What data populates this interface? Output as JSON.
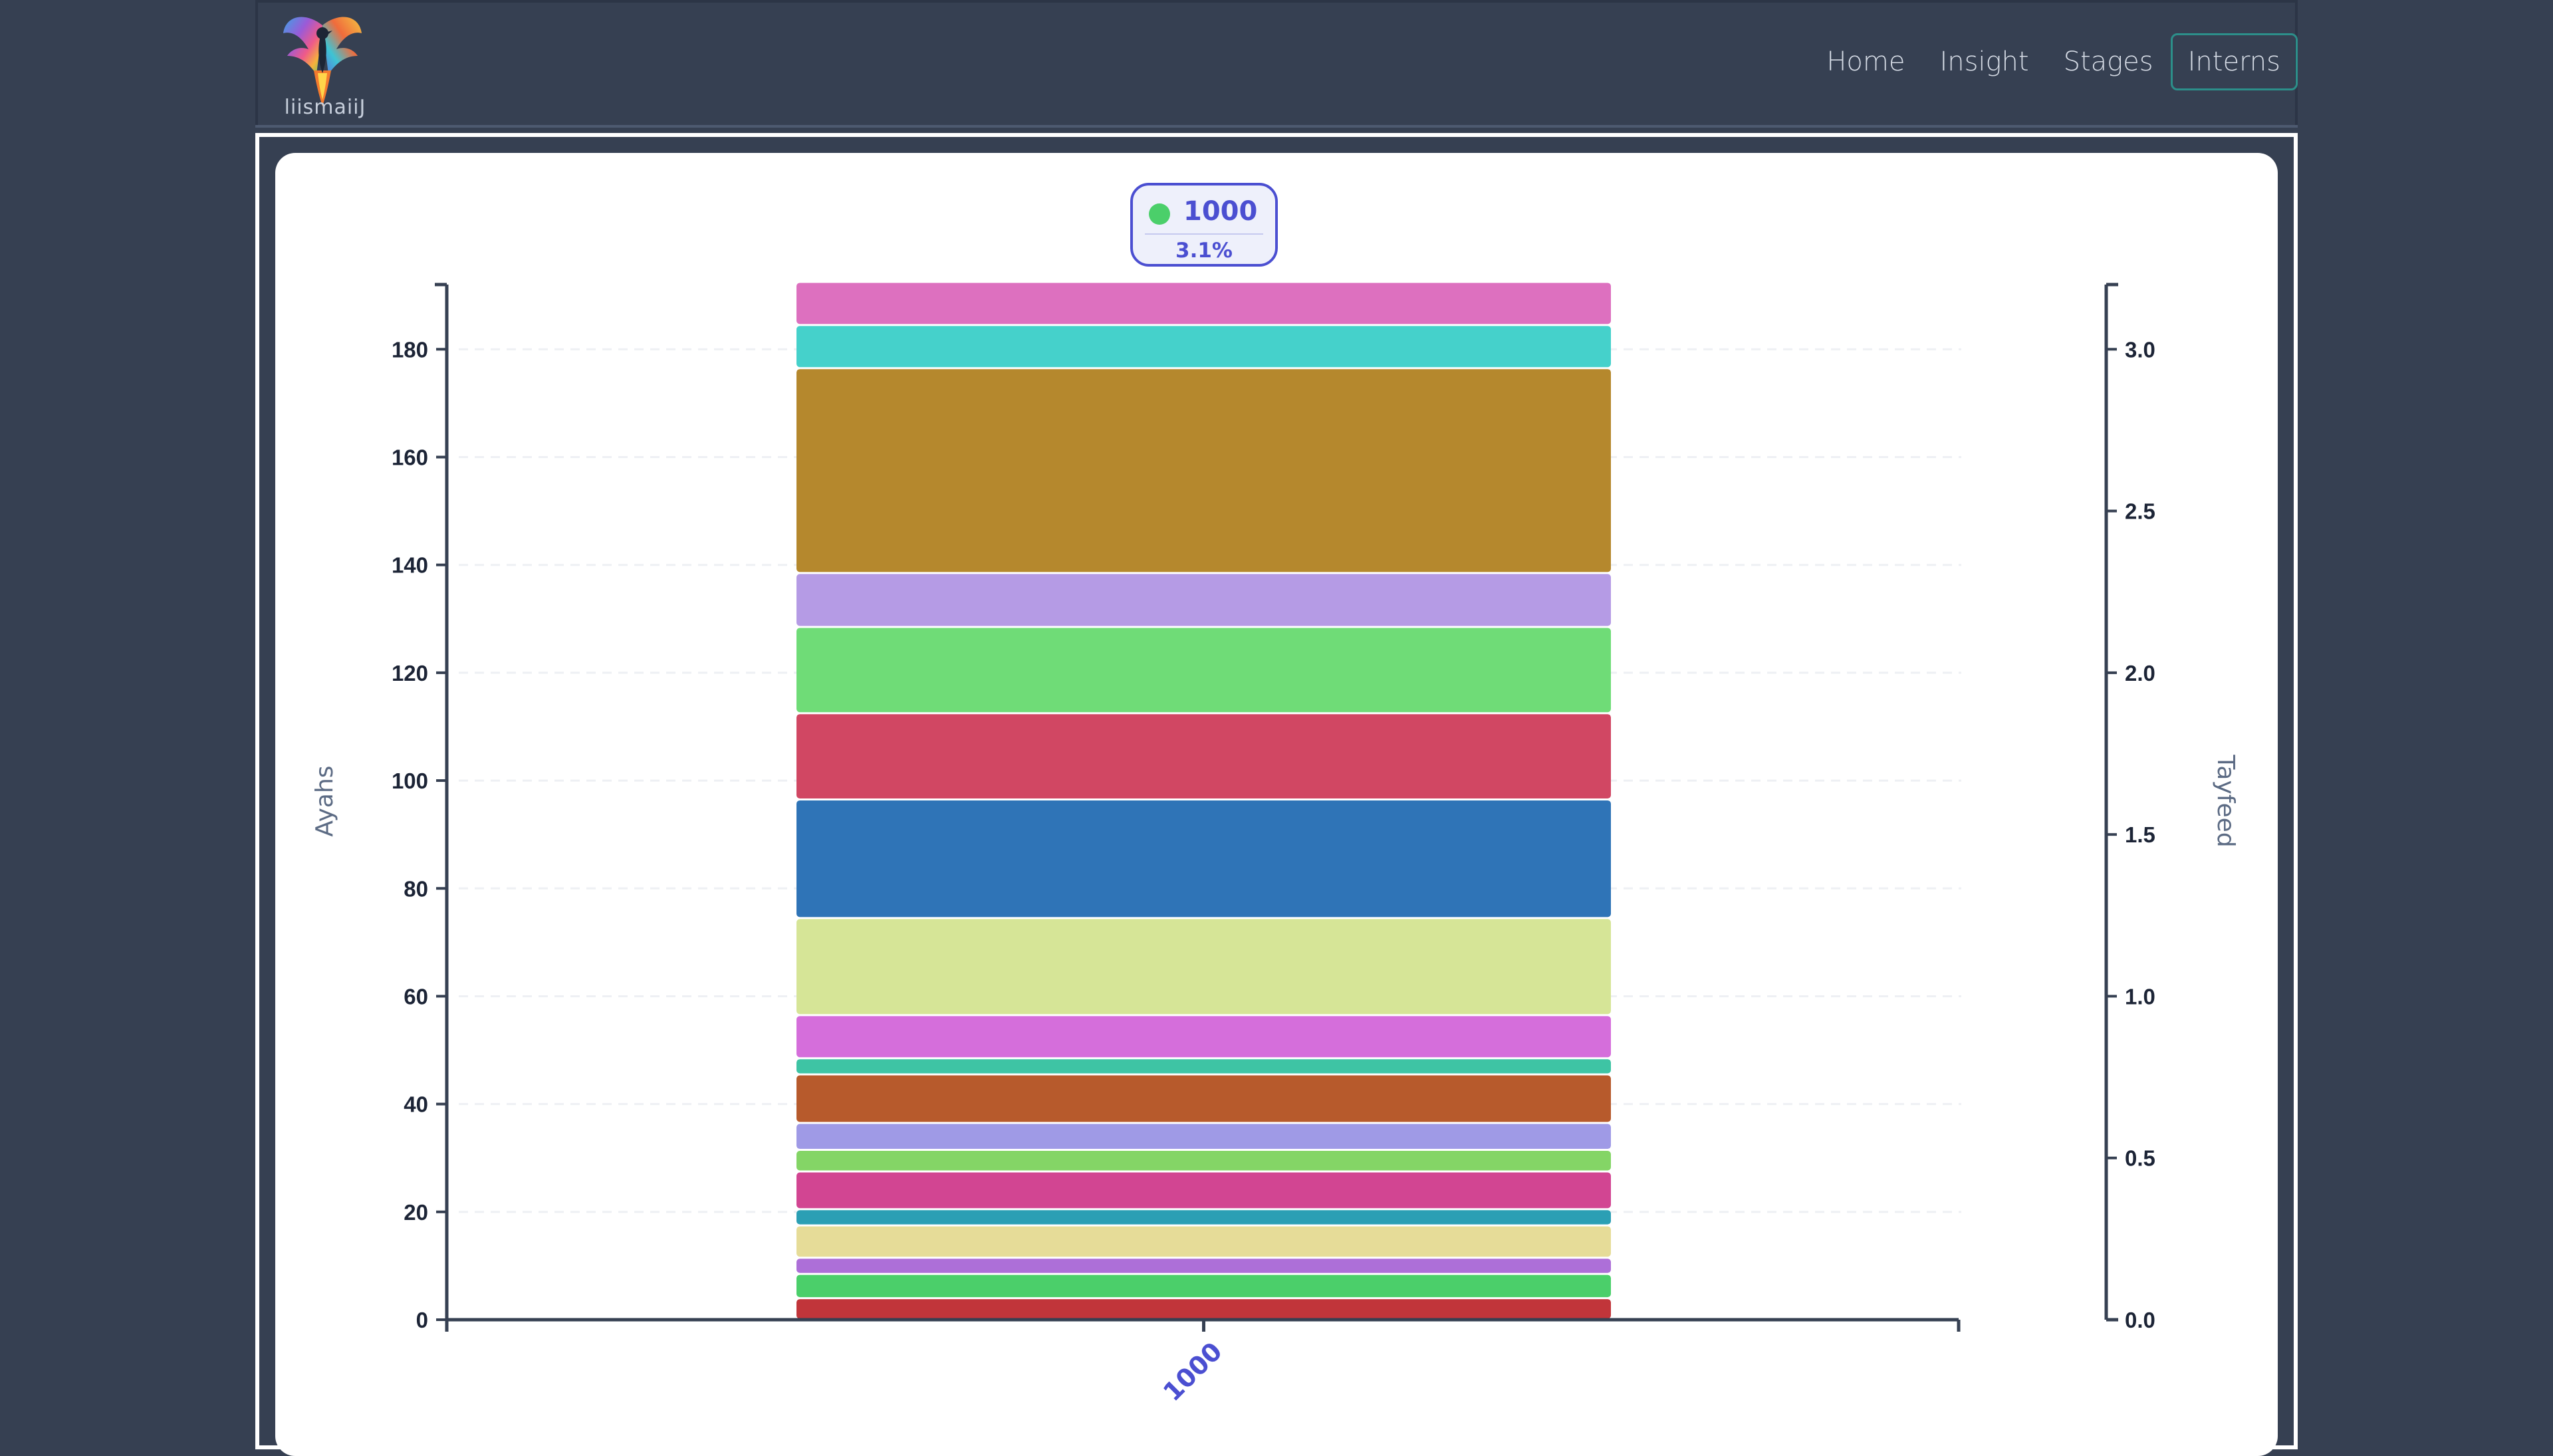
{
  "nav": {
    "logo_text": "liismaiiJ",
    "links": [
      {
        "label": "Home",
        "active": false
      },
      {
        "label": "Insight",
        "active": false
      },
      {
        "label": "Stages",
        "active": false
      },
      {
        "label": "Interns",
        "active": true
      }
    ]
  },
  "legend": {
    "label": "1000",
    "percent": "3.1%",
    "color": "#4bcf6a"
  },
  "chart_data": {
    "type": "bar",
    "stacked": true,
    "categories": [
      "1000"
    ],
    "ylabel": "Ayahs",
    "y2label": "Tayfeed",
    "ylim": [
      0,
      192
    ],
    "y2lim": [
      0,
      3.2
    ],
    "yticks": [
      0,
      20,
      40,
      60,
      80,
      100,
      120,
      140,
      160,
      180
    ],
    "y2ticks": [
      "0.0",
      "0.5",
      "1.0",
      "1.5",
      "2.0",
      "2.5",
      "3.0"
    ],
    "grid": true,
    "segments": [
      {
        "value": 4,
        "color": "#c1353a"
      },
      {
        "value": 4.5,
        "color": "#4bcf6a"
      },
      {
        "value": 3,
        "color": "#ad6fd8"
      },
      {
        "value": 6,
        "color": "#e6dc98"
      },
      {
        "value": 3,
        "color": "#2b9fb4"
      },
      {
        "value": 7,
        "color": "#d24592"
      },
      {
        "value": 4,
        "color": "#84d566"
      },
      {
        "value": 5,
        "color": "#9f9ae6"
      },
      {
        "value": 9,
        "color": "#b75a2c"
      },
      {
        "value": 3,
        "color": "#3ec4a4"
      },
      {
        "value": 8,
        "color": "#d56edb"
      },
      {
        "value": 18,
        "color": "#d6e597"
      },
      {
        "value": 22,
        "color": "#2f74b7"
      },
      {
        "value": 16,
        "color": "#d14763"
      },
      {
        "value": 16,
        "color": "#6fdc77"
      },
      {
        "value": 10,
        "color": "#b59be5"
      },
      {
        "value": 38,
        "color": "#b5882d"
      },
      {
        "value": 8,
        "color": "#45d1cb"
      },
      {
        "value": 8,
        "color": "#dd70bf"
      }
    ]
  }
}
